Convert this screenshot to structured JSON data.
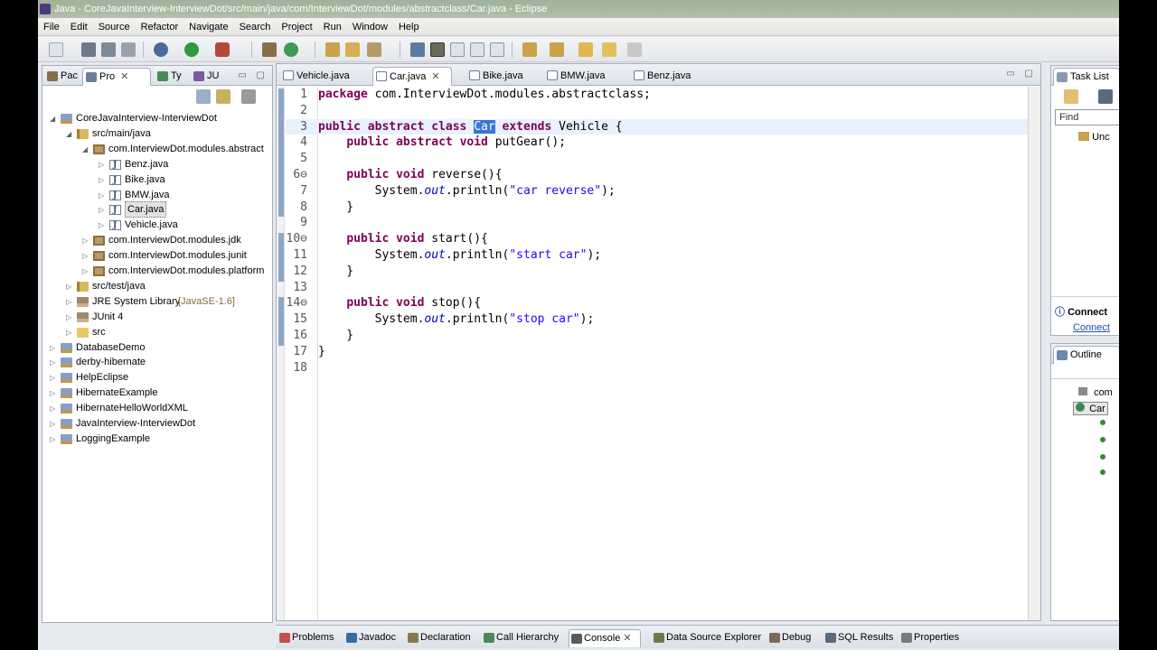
{
  "window": {
    "title": "Java - CoreJavaInterview-InterviewDot/src/main/java/com/InterviewDot/modules/abstractclass/Car.java - Eclipse"
  },
  "menu": [
    "File",
    "Edit",
    "Source",
    "Refactor",
    "Navigate",
    "Search",
    "Project",
    "Run",
    "Window",
    "Help"
  ],
  "explorer": {
    "tabs": [
      {
        "label": "Pac",
        "active": false
      },
      {
        "label": "Pro",
        "active": true
      },
      {
        "label": "Ty",
        "active": false
      },
      {
        "label": "JU",
        "active": false
      }
    ],
    "tree": [
      {
        "label": "CoreJavaInterview-InterviewDot",
        "depth": 0,
        "expanded": true,
        "icon": "project-icon"
      },
      {
        "label": "src/main/java",
        "depth": 1,
        "expanded": true,
        "icon": "source-folder-icon"
      },
      {
        "label": "com.InterviewDot.modules.abstract",
        "depth": 2,
        "expanded": true,
        "icon": "package-icon"
      },
      {
        "label": "Benz.java",
        "depth": 3,
        "expanded": false,
        "icon": "java-file-icon"
      },
      {
        "label": "Bike.java",
        "depth": 3,
        "expanded": false,
        "icon": "java-file-icon"
      },
      {
        "label": "BMW.java",
        "depth": 3,
        "expanded": false,
        "icon": "java-file-icon"
      },
      {
        "label": "Car.java",
        "depth": 3,
        "expanded": false,
        "icon": "java-file-icon",
        "selected": true
      },
      {
        "label": "Vehicle.java",
        "depth": 3,
        "expanded": false,
        "icon": "java-file-icon"
      },
      {
        "label": "com.InterviewDot.modules.jdk",
        "depth": 2,
        "expanded": false,
        "icon": "package-icon"
      },
      {
        "label": "com.InterviewDot.modules.junit",
        "depth": 2,
        "expanded": false,
        "icon": "package-icon"
      },
      {
        "label": "com.InterviewDot.modules.platform",
        "depth": 2,
        "expanded": false,
        "icon": "package-icon"
      },
      {
        "label": "src/test/java",
        "depth": 1,
        "expanded": false,
        "icon": "source-folder-icon"
      },
      {
        "label": "JRE System Library",
        "suffix": "[JavaSE-1.6]",
        "depth": 1,
        "expanded": false,
        "icon": "library-icon"
      },
      {
        "label": "JUnit 4",
        "depth": 1,
        "expanded": false,
        "icon": "library-icon"
      },
      {
        "label": "src",
        "depth": 1,
        "expanded": false,
        "icon": "folder-icon"
      },
      {
        "label": "DatabaseDemo",
        "depth": 0,
        "expanded": false,
        "icon": "project-icon"
      },
      {
        "label": "derby-hibernate",
        "depth": 0,
        "expanded": false,
        "icon": "project-icon"
      },
      {
        "label": "HelpEclipse",
        "depth": 0,
        "expanded": false,
        "icon": "project-icon"
      },
      {
        "label": "HibernateExample",
        "depth": 0,
        "expanded": false,
        "icon": "project-icon"
      },
      {
        "label": "HibernateHelloWorldXML",
        "depth": 0,
        "expanded": false,
        "icon": "project-icon"
      },
      {
        "label": "JavaInterview-InterviewDot",
        "depth": 0,
        "expanded": false,
        "icon": "project-icon"
      },
      {
        "label": "LoggingExample",
        "depth": 0,
        "expanded": false,
        "icon": "project-icon"
      }
    ]
  },
  "editor": {
    "tabs": [
      {
        "label": "Vehicle.java",
        "active": false
      },
      {
        "label": "Car.java",
        "active": true
      },
      {
        "label": "Bike.java",
        "active": false
      },
      {
        "label": "BMW.java",
        "active": false
      },
      {
        "label": "Benz.java",
        "active": false
      }
    ],
    "current_line": 3,
    "lines": [
      {
        "n": "1",
        "tokens": [
          [
            "kw",
            "package"
          ],
          [
            "",
            " com.InterviewDot.modules.abstractclass;"
          ]
        ]
      },
      {
        "n": "2",
        "tokens": []
      },
      {
        "n": "3",
        "tokens": [
          [
            "kw",
            "public"
          ],
          [
            "",
            " "
          ],
          [
            "kw",
            "abstract"
          ],
          [
            "",
            " "
          ],
          [
            "kw",
            "class"
          ],
          [
            "",
            " "
          ],
          [
            "sel",
            "Car"
          ],
          [
            "",
            " "
          ],
          [
            "kw",
            "extends"
          ],
          [
            "",
            " Vehicle {"
          ]
        ]
      },
      {
        "n": "4",
        "tokens": [
          [
            "",
            "    "
          ],
          [
            "kw",
            "public"
          ],
          [
            "",
            " "
          ],
          [
            "kw",
            "abstract"
          ],
          [
            "",
            " "
          ],
          [
            "kw",
            "void"
          ],
          [
            "",
            " putGear();"
          ]
        ]
      },
      {
        "n": "5",
        "tokens": []
      },
      {
        "n": "6⊖",
        "tokens": [
          [
            "",
            "    "
          ],
          [
            "kw",
            "public"
          ],
          [
            "",
            " "
          ],
          [
            "kw",
            "void"
          ],
          [
            "",
            " reverse(){"
          ]
        ]
      },
      {
        "n": "7",
        "tokens": [
          [
            "",
            "        System."
          ],
          [
            "ital",
            "out"
          ],
          [
            "",
            ".println("
          ],
          [
            "str",
            "\"car reverse\""
          ],
          [
            "",
            ");"
          ]
        ]
      },
      {
        "n": "8",
        "tokens": [
          [
            "",
            "    }"
          ]
        ]
      },
      {
        "n": "9",
        "tokens": []
      },
      {
        "n": "10⊖",
        "tokens": [
          [
            "",
            "    "
          ],
          [
            "kw",
            "public"
          ],
          [
            "",
            " "
          ],
          [
            "kw",
            "void"
          ],
          [
            "",
            " start(){"
          ]
        ]
      },
      {
        "n": "11",
        "tokens": [
          [
            "",
            "        System."
          ],
          [
            "ital",
            "out"
          ],
          [
            "",
            ".println("
          ],
          [
            "str",
            "\"start car\""
          ],
          [
            "",
            ");"
          ]
        ]
      },
      {
        "n": "12",
        "tokens": [
          [
            "",
            "    }"
          ]
        ]
      },
      {
        "n": "13",
        "tokens": []
      },
      {
        "n": "14⊖",
        "tokens": [
          [
            "",
            "    "
          ],
          [
            "kw",
            "public"
          ],
          [
            "",
            " "
          ],
          [
            "kw",
            "void"
          ],
          [
            "",
            " stop(){"
          ]
        ]
      },
      {
        "n": "15",
        "tokens": [
          [
            "",
            "        System."
          ],
          [
            "ital",
            "out"
          ],
          [
            "",
            ".println("
          ],
          [
            "str",
            "\"stop car\""
          ],
          [
            "",
            ");"
          ]
        ]
      },
      {
        "n": "16",
        "tokens": [
          [
            "",
            "    }"
          ]
        ]
      },
      {
        "n": "17",
        "tokens": [
          [
            "",
            "}"
          ]
        ]
      },
      {
        "n": "18",
        "tokens": []
      }
    ]
  },
  "tasklist": {
    "tab": "Task List",
    "find_placeholder": "Find",
    "uncategorized": "Unc",
    "connect_title": "Connect",
    "connect_link": "Connect"
  },
  "outline": {
    "tab": "Outline",
    "items": [
      "com",
      "Car"
    ]
  },
  "bottom_tabs": [
    {
      "label": "Problems",
      "active": false
    },
    {
      "label": "Javadoc",
      "active": false
    },
    {
      "label": "Declaration",
      "active": false
    },
    {
      "label": "Call Hierarchy",
      "active": false
    },
    {
      "label": "Console",
      "active": true
    },
    {
      "label": "Data Source Explorer",
      "active": false
    },
    {
      "label": "Debug",
      "active": false
    },
    {
      "label": "SQL Results",
      "active": false
    },
    {
      "label": "Properties",
      "active": false
    }
  ]
}
